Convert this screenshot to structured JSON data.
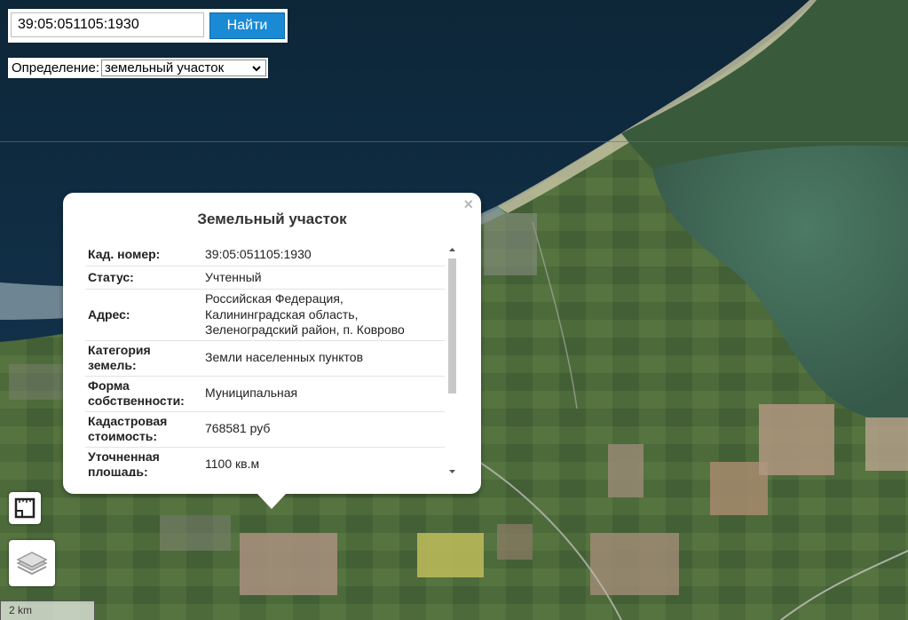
{
  "search": {
    "value": "39:05:051105:1930",
    "button_label": "Найти"
  },
  "definition": {
    "label": "Определение:",
    "selected": "земельный участок"
  },
  "popup": {
    "title": "Земельный участок",
    "close_glyph": "×",
    "rows": [
      {
        "label": [
          "Кад. номер:"
        ],
        "value": [
          "39:05:051105:1930"
        ]
      },
      {
        "label": [
          "Статус:"
        ],
        "value": [
          "Учтенный"
        ]
      },
      {
        "label": [
          "Адрес:"
        ],
        "value": [
          "Российская Федерация,",
          "Калининградская область,",
          "Зеленоградский район, п. Коврово"
        ]
      },
      {
        "label": [
          "Категория",
          "земель:"
        ],
        "value": [
          "Земли населенных пунктов"
        ]
      },
      {
        "label": [
          "Форма",
          "собственности:"
        ],
        "value": [
          "Муниципальная"
        ]
      },
      {
        "label": [
          "Кадастровая",
          "стоимость:"
        ],
        "value": [
          "768581 руб"
        ]
      },
      {
        "label": [
          "Уточненная",
          "площадь:"
        ],
        "value": [
          "1100 кв.м"
        ]
      }
    ]
  },
  "controls": {
    "ruler_icon": "ruler-icon",
    "layers_icon": "layers-icon"
  },
  "scale": {
    "label": "2 km"
  },
  "colors": {
    "sea": "#0e2a3e",
    "land": "#4a6b3e",
    "lagoon": "#3f6a56",
    "button": "#1a8ad4"
  }
}
